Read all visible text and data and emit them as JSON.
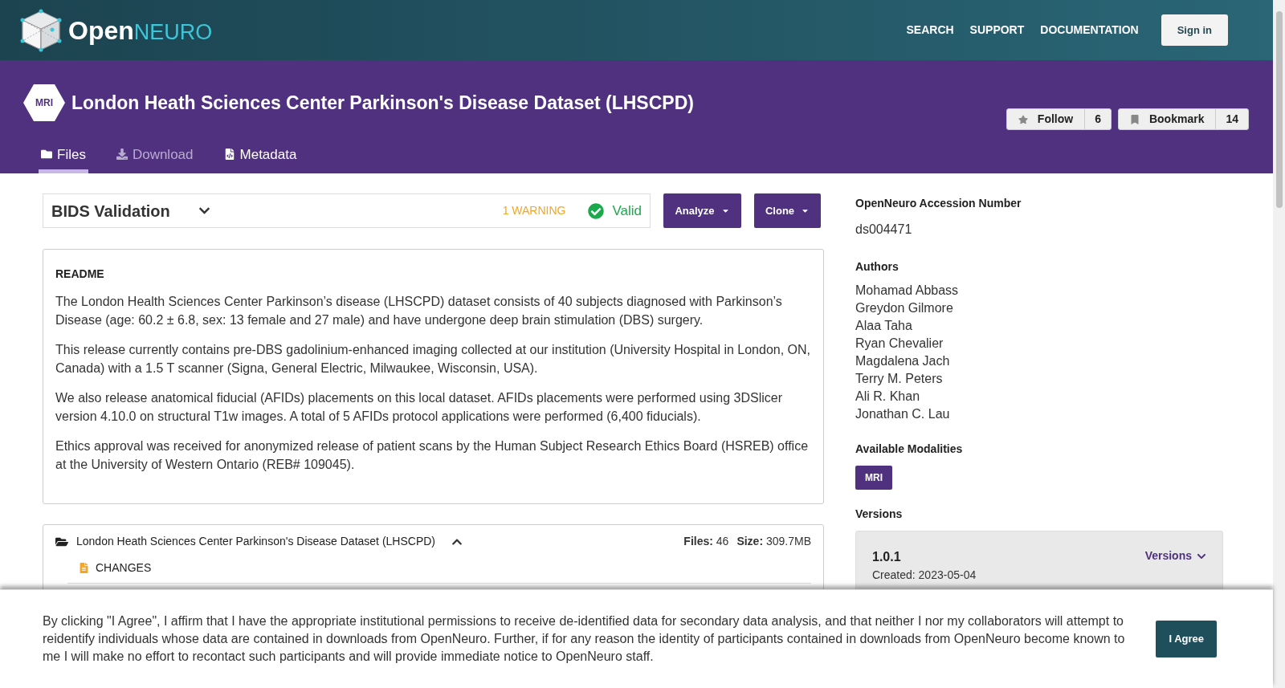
{
  "header": {
    "logo": {
      "open": "Open",
      "neuro": "NEURO"
    },
    "nav": [
      "SEARCH",
      "SUPPORT",
      "DOCUMENTATION"
    ],
    "sign_in": "Sign in"
  },
  "dataset": {
    "modality_badge": "MRI",
    "title": "London Heath Sciences Center Parkinson's Disease Dataset (LHSCPD)",
    "follow": {
      "label": "Follow",
      "count": "6"
    },
    "bookmark": {
      "label": "Bookmark",
      "count": "14"
    }
  },
  "tabs": [
    {
      "kind": "files",
      "label": "Files",
      "selected": true,
      "disabled": false
    },
    {
      "kind": "download",
      "label": "Download",
      "selected": false,
      "disabled": true
    },
    {
      "kind": "metadata",
      "label": "Metadata",
      "selected": false,
      "disabled": false
    }
  ],
  "validation": {
    "title": "BIDS Validation",
    "warnings": "1 WARNING",
    "status": "Valid",
    "valid": true
  },
  "actions": [
    "Analyze",
    "Clone"
  ],
  "readme": {
    "heading": "README",
    "paragraphs": [
      "The London Health Sciences Center Parkinson’s disease (LHSCPD) dataset consists of 40 subjects diagnosed with Parkinson’s Disease (age: 60.2 ± 6.8, sex: 13 female and 27 male) and have undergone deep brain stimulation (DBS) surgery.",
      "This release currently contains pre-DBS gadolinium-enhanced imaging collected at our institution (University Hospital in London, ON, Canada) with a 1.5 T scanner (Signa, General Electric, Milwaukee, Wisconsin, USA).",
      "We also release anatomical fiducial (AFIDs) placements on this local dataset. AFIDs placements were performed using 3DSlicer version 4.10.0 on structural T1w images. A total of 5 AFIDs protocol applications were performed (6,400 fiducials).",
      "Ethics approval was received for anonymized release of patient scans by the Human Subject Research Ethics Board (HSREB) office at the University of Western Ontario (REB# 109045)."
    ]
  },
  "files": {
    "root": "London Heath Sciences Center Parkinson's Disease Dataset (LHSCPD)",
    "expanded": true,
    "files_label": "Files:",
    "files_count": "46",
    "size_label": "Size:",
    "size": "309.7MB",
    "items": [
      {
        "name": "CHANGES"
      }
    ]
  },
  "sidebar": {
    "accession": {
      "heading": "OpenNeuro Accession Number",
      "value": "ds004471"
    },
    "authors": {
      "heading": "Authors",
      "names": [
        "Mohamad Abbass",
        "Greydon Gilmore",
        "Alaa Taha",
        "Ryan Chevalier",
        "Magdalena Jach",
        "Terry M. Peters",
        "Ali R. Khan",
        "Jonathan C. Lau"
      ]
    },
    "modalities": {
      "heading": "Available Modalities",
      "items": [
        "MRI"
      ]
    },
    "versions": {
      "heading": "Versions",
      "current": "1.0.1",
      "created": "Created: 2023-05-04",
      "toggle": "Versions"
    }
  },
  "consent": {
    "text": "By clicking \"I Agree\", I affirm that I have the appropriate institutional permissions to receive de-identified data for secondary data analysis, and that neither I nor my collaborators will attempt to reidentify individuals whose data are contained in downloads from OpenNeuro. Further, if for any reason the identity of participants contained in downloads from OpenNeuro become known to me I will make no effort to recontact such participants and will provide immediate notice to OpenNeuro staff.",
    "button": "I Agree"
  }
}
